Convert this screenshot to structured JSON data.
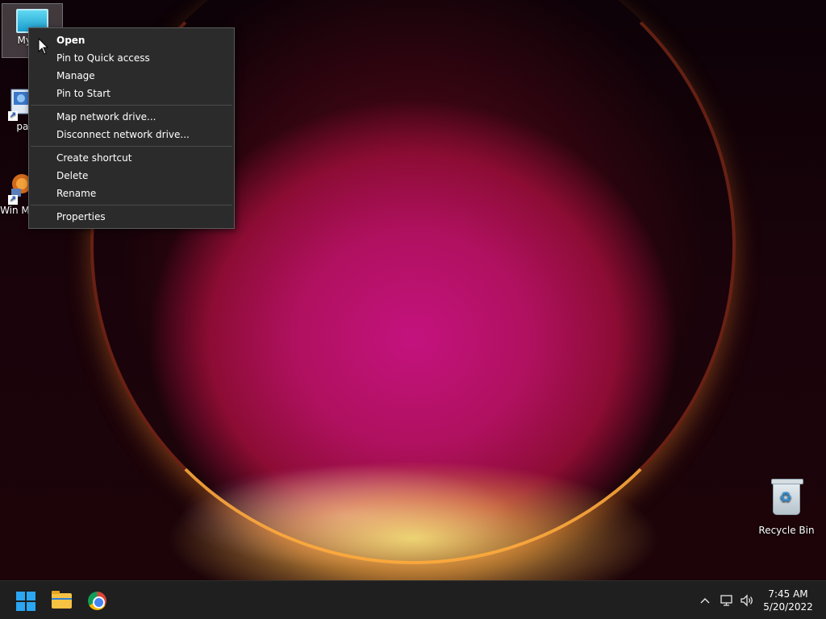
{
  "desktop": {
    "icons": [
      {
        "label": "My Co",
        "icon": "computer-icon"
      },
      {
        "label": "pair",
        "icon": "paint-app-icon"
      },
      {
        "label": "Win Movie",
        "icon": "movie-maker-icon"
      },
      {
        "label": "Recycle Bin",
        "icon": "recycle-bin-icon"
      }
    ]
  },
  "context_menu": {
    "groups": [
      [
        "Open",
        "Pin to Quick access",
        "Manage",
        "Pin to Start"
      ],
      [
        "Map network drive...",
        "Disconnect network drive..."
      ],
      [
        "Create shortcut",
        "Delete",
        "Rename"
      ],
      [
        "Properties"
      ]
    ]
  },
  "taskbar": {
    "pinned": [
      {
        "name": "Start",
        "icon": "windows-logo-icon"
      },
      {
        "name": "File Explorer",
        "icon": "folder-icon"
      },
      {
        "name": "Google Chrome",
        "icon": "chrome-icon"
      }
    ],
    "tray": {
      "chevron": "^",
      "network_icon": "network-icon",
      "volume_icon": "volume-icon"
    },
    "clock": {
      "time": "7:45 AM",
      "date": "5/20/2022"
    }
  },
  "colors": {
    "taskbar_bg": "#1f1f1f",
    "menu_bg": "#2b2b2b",
    "accent": "#2aa6f2"
  }
}
